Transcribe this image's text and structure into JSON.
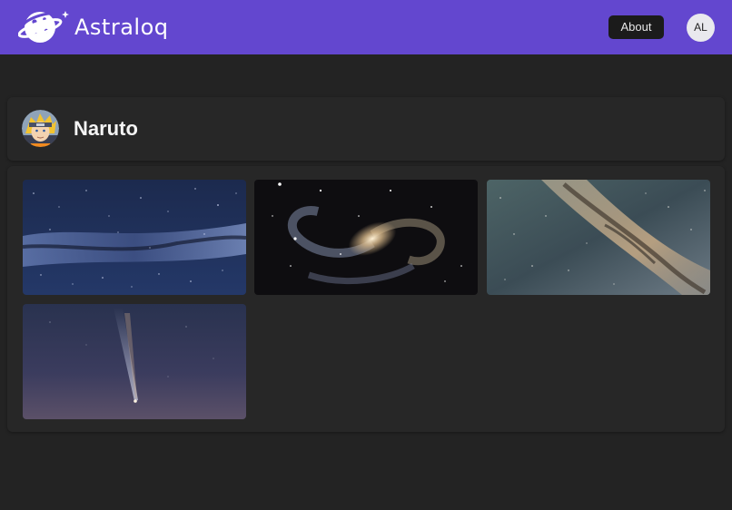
{
  "header": {
    "brand_name": "Astraloq",
    "logo_icon": "planet-logo-icon",
    "about_label": "About",
    "user_initials": "AL",
    "accent_color": "#6347cf"
  },
  "profile": {
    "name": "Naruto",
    "avatar_icon": "anime-character-avatar"
  },
  "gallery": {
    "images": [
      {
        "subject": "milky-way-blue-image"
      },
      {
        "subject": "barred-spiral-galaxy-image"
      },
      {
        "subject": "milky-way-core-image"
      },
      {
        "subject": "comet-twilight-image"
      }
    ]
  }
}
